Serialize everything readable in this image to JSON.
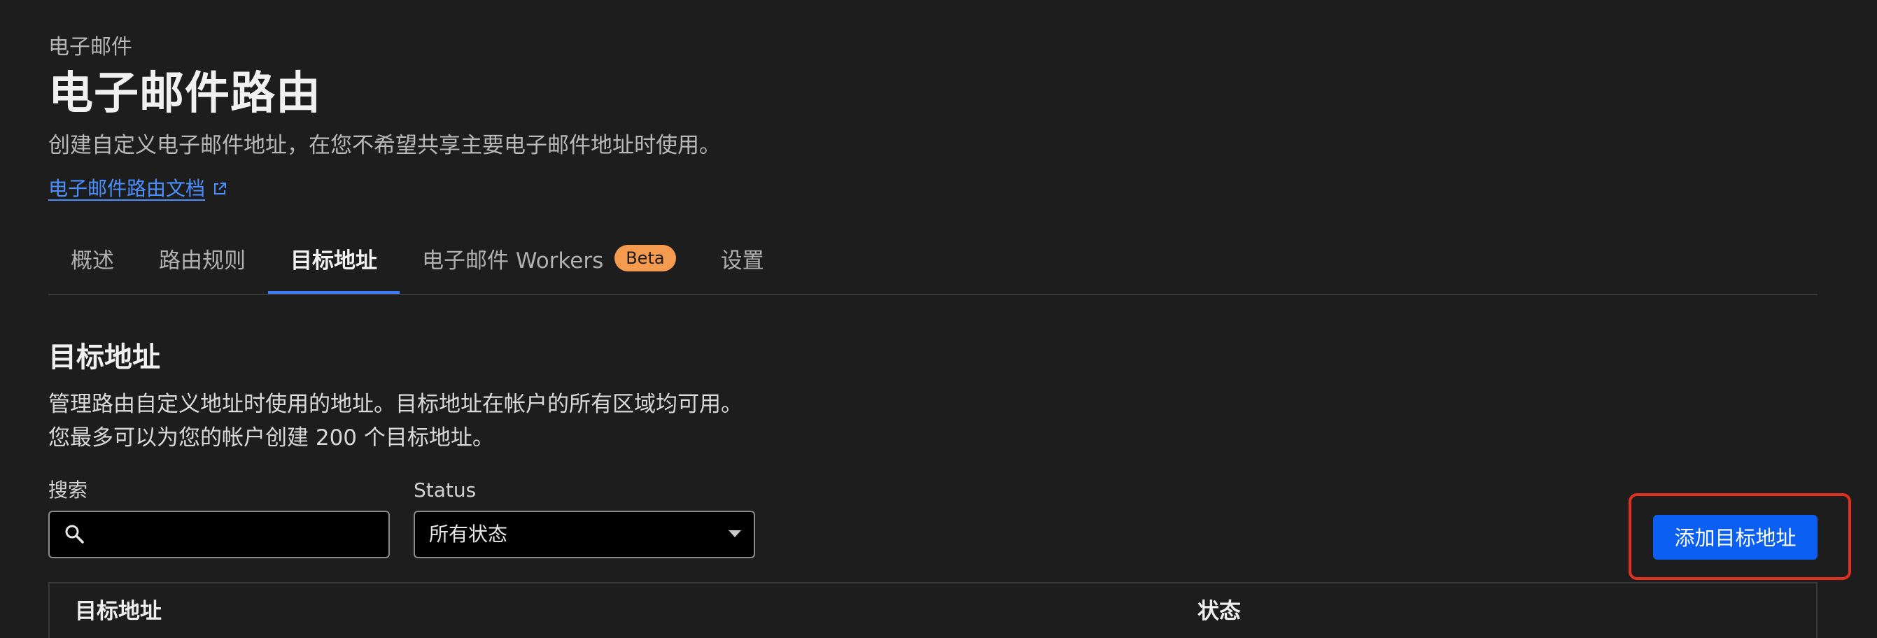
{
  "header": {
    "eyebrow": "电子邮件",
    "title": "电子邮件路由",
    "subtitle": "创建自定义电子邮件地址，在您不希望共享主要电子邮件地址时使用。",
    "doc_link": "电子邮件路由文档"
  },
  "tabs": [
    {
      "label": "概述"
    },
    {
      "label": "路由规则"
    },
    {
      "label": "目标地址",
      "active": true
    },
    {
      "label": "电子邮件 Workers",
      "badge": "Beta"
    },
    {
      "label": "设置"
    }
  ],
  "section": {
    "title": "目标地址",
    "desc_line1": "管理路由自定义地址时使用的地址。目标地址在帐户的所有区域均可用。",
    "desc_line2": "您最多可以为您的帐户创建 200 个目标地址。"
  },
  "filters": {
    "search_label": "搜索",
    "search_value": "",
    "status_label": "Status",
    "status_value": "所有状态"
  },
  "actions": {
    "add_button": "添加目标地址"
  },
  "table": {
    "columns": [
      "目标地址",
      "状态"
    ]
  },
  "colors": {
    "background": "#1d1d1d",
    "accent": "#0b5ff2",
    "link": "#4a90ff",
    "badge": "#f49b4f",
    "highlight": "#e0301e"
  }
}
